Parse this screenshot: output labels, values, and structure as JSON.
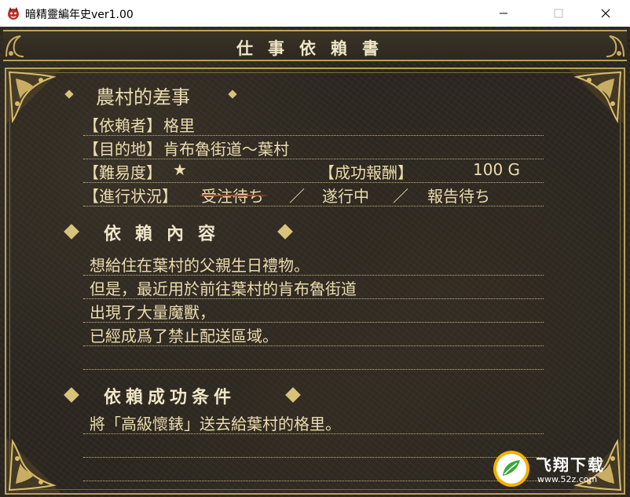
{
  "window": {
    "title": "暗精靈編年史ver1.00",
    "icon": "demon-app-icon"
  },
  "header": {
    "title": "仕事依賴書"
  },
  "quest": {
    "name": "農村的差事",
    "client_label": "【依賴者】",
    "client": "格里",
    "destination_label": "【目的地】",
    "destination": "肯布魯街道～葉村",
    "difficulty_label": "【難易度】",
    "difficulty": "★",
    "reward_label": "【成功報酬】",
    "reward": "100 G",
    "status_label": "【進行状況】",
    "status_options": [
      "受注待ち",
      "遂行中",
      "報告待ち"
    ],
    "status_separator": "／"
  },
  "content": {
    "heading": "依賴內容",
    "lines": [
      "想給住在葉村的父親生日禮物。",
      "但是，最近用於前往葉村的肯布魯街道",
      "出現了大量魔獸，",
      "已經成爲了禁止配送區域。"
    ]
  },
  "conditions": {
    "heading": "依賴成功条件",
    "lines": [
      "將「高級懷錶」送去給葉村的格里。"
    ]
  },
  "watermark": {
    "brand": "飞翔下载",
    "url": "www.52z.com"
  },
  "colors": {
    "text": "#ecdcae",
    "gold": "#b9a15c",
    "strike": "#d23a2a",
    "background": "#2c2720"
  }
}
